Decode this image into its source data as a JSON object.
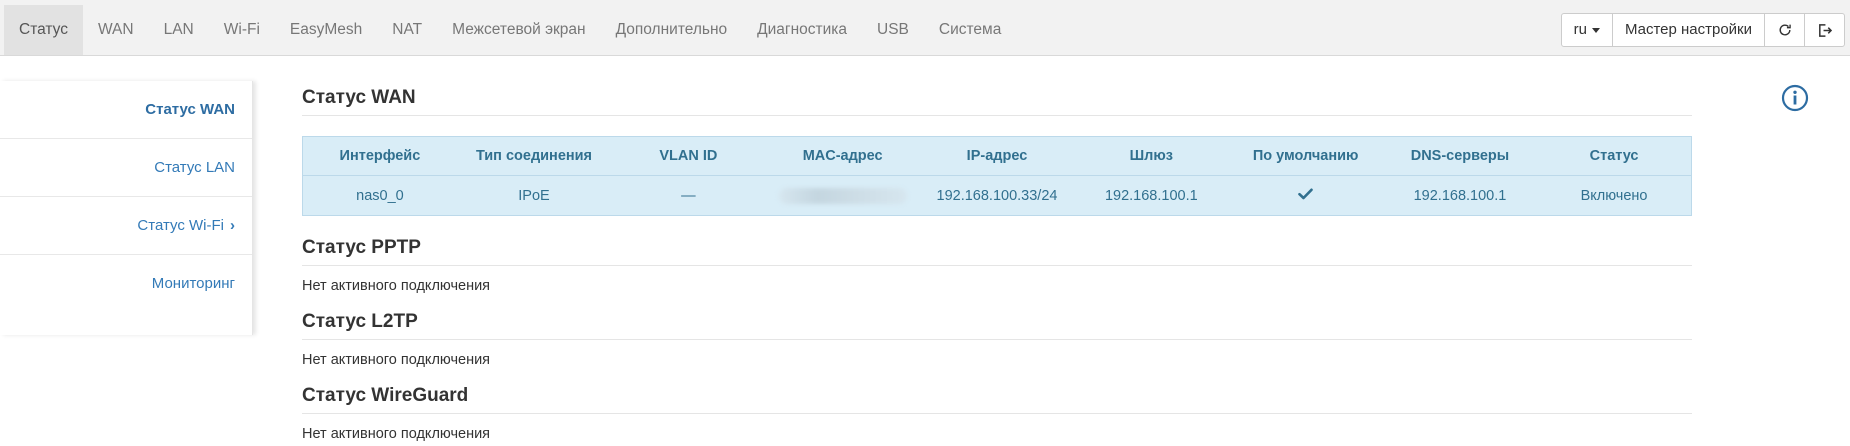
{
  "nav": {
    "tabs": [
      {
        "label": "Статус",
        "active": true
      },
      {
        "label": "WAN"
      },
      {
        "label": "LAN"
      },
      {
        "label": "Wi-Fi"
      },
      {
        "label": "EasyMesh"
      },
      {
        "label": "NAT"
      },
      {
        "label": "Межсетевой экран"
      },
      {
        "label": "Дополнительно"
      },
      {
        "label": "Диагностика"
      },
      {
        "label": "USB"
      },
      {
        "label": "Система"
      }
    ],
    "language": "ru",
    "wizard_label": "Мастер настройки",
    "refresh_icon": "refresh-icon",
    "logout_icon": "logout-icon"
  },
  "sidebar": {
    "items": [
      {
        "label": "Статус WAN",
        "active": true
      },
      {
        "label": "Статус LAN"
      },
      {
        "label": "Статус Wi-Fi",
        "chevron": "›"
      },
      {
        "label": "Мониторинг"
      }
    ]
  },
  "wan": {
    "title": "Статус WAN",
    "headers": [
      "Интерфейс",
      "Тип соединения",
      "VLAN ID",
      "MAC-адрес",
      "IP-адрес",
      "Шлюз",
      "По умолчанию",
      "DNS-серверы",
      "Статус"
    ],
    "row": {
      "interface": "nas0_0",
      "type": "IPoE",
      "vlan": "—",
      "mac": "",
      "ip": "192.168.100.33/24",
      "gateway": "192.168.100.1",
      "default_icon": "check-icon",
      "dns": "192.168.100.1",
      "status": "Включено"
    }
  },
  "pptp": {
    "title": "Статус PPTP",
    "text": "Нет активного подключения"
  },
  "l2tp": {
    "title": "Статус L2TP",
    "text": "Нет активного подключения"
  },
  "wireguard": {
    "title": "Статус WireGuard",
    "text": "Нет активного подключения"
  },
  "colors": {
    "accent": "#337ab7",
    "table_bg": "#d9edf7",
    "table_text": "#31708f"
  }
}
